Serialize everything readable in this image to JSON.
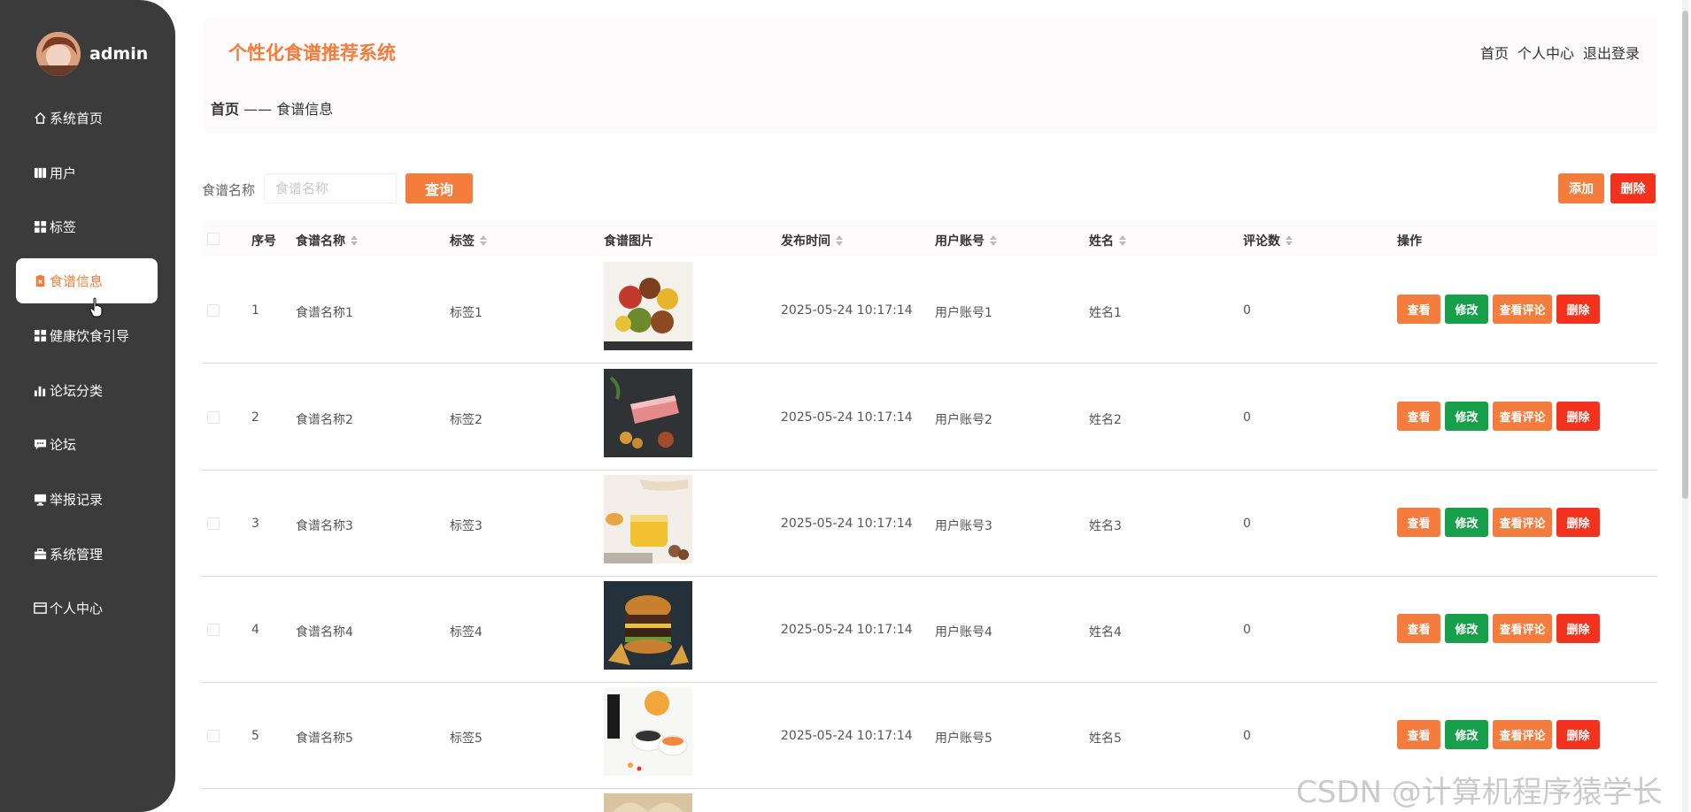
{
  "colors": {
    "accent": "#f47c3c",
    "sidebar": "#3b3b3b",
    "edit": "#17a04a",
    "danger": "#f2321c"
  },
  "sidebar": {
    "user": "admin",
    "items": [
      {
        "label": "系统首页",
        "icon": "home-icon"
      },
      {
        "label": "用户",
        "icon": "user-icon"
      },
      {
        "label": "标签",
        "icon": "grid-icon"
      },
      {
        "label": "食谱信息",
        "icon": "clipboard-icon",
        "active": true
      },
      {
        "label": "健康饮食引导",
        "icon": "grid-icon"
      },
      {
        "label": "论坛分类",
        "icon": "bar-chart-icon"
      },
      {
        "label": "论坛",
        "icon": "chat-icon"
      },
      {
        "label": "举报记录",
        "icon": "monitor-icon"
      },
      {
        "label": "系统管理",
        "icon": "briefcase-icon"
      },
      {
        "label": "个人中心",
        "icon": "card-icon"
      }
    ]
  },
  "header": {
    "title": "个性化食谱推荐系统",
    "links": [
      "首页",
      "个人中心",
      "退出登录"
    ]
  },
  "breadcrumb": {
    "home": "首页",
    "separator": " —— ",
    "current": "食谱信息"
  },
  "search": {
    "label": "食谱名称",
    "placeholder": "食谱名称",
    "query_label": "查询"
  },
  "toolbar": {
    "add_label": "添加",
    "delete_label": "删除"
  },
  "table": {
    "columns": [
      "序号",
      "食谱名称",
      "标签",
      "食谱图片",
      "发布时间",
      "用户账号",
      "姓名",
      "评论数",
      "操作"
    ],
    "actions": {
      "view": "查看",
      "edit": "修改",
      "comments": "查看评论",
      "delete": "删除"
    },
    "rows": [
      {
        "index": "1",
        "name": "食谱名称1",
        "tag": "标签1",
        "image": "kebab-image",
        "time": "2025-05-24 10:17:14",
        "account": "用户账号1",
        "person": "姓名1",
        "comments": "0"
      },
      {
        "index": "2",
        "name": "食谱名称2",
        "tag": "标签2",
        "image": "ham-image",
        "time": "2025-05-24 10:17:14",
        "account": "用户账号2",
        "person": "姓名2",
        "comments": "0"
      },
      {
        "index": "3",
        "name": "食谱名称3",
        "tag": "标签3",
        "image": "honey-image",
        "time": "2025-05-24 10:17:14",
        "account": "用户账号3",
        "person": "姓名3",
        "comments": "0"
      },
      {
        "index": "4",
        "name": "食谱名称4",
        "tag": "标签4",
        "image": "burger-image",
        "time": "2025-05-24 10:17:14",
        "account": "用户账号4",
        "person": "姓名4",
        "comments": "0"
      },
      {
        "index": "5",
        "name": "食谱名称5",
        "tag": "标签5",
        "image": "sushi-image",
        "time": "2025-05-24 10:17:14",
        "account": "用户账号5",
        "person": "姓名5",
        "comments": "0"
      }
    ]
  },
  "watermark": "CSDN @计算机程序猿学长"
}
